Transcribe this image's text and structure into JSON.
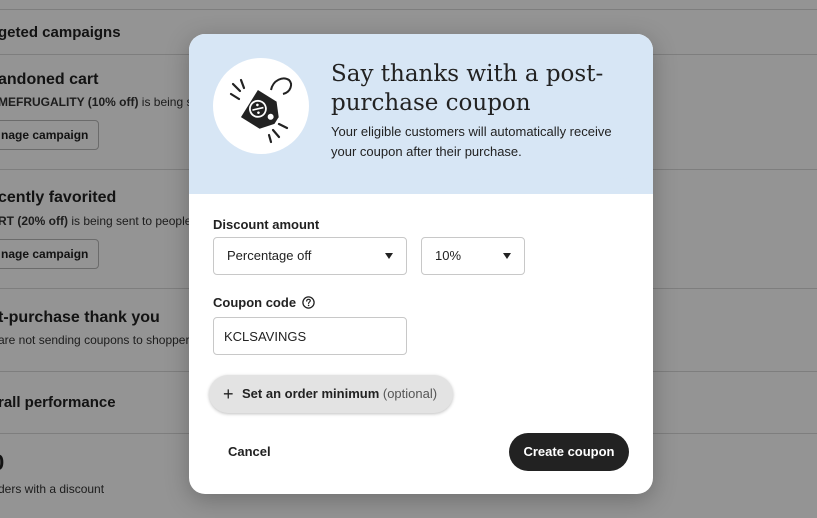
{
  "background": {
    "sections": [
      {
        "title": "geted campaigns"
      },
      {
        "title": "andoned cart",
        "desc_bold": "MEFRUGALITY (10% off)",
        "desc_rest": " is being sent",
        "button": "nage campaign"
      },
      {
        "title": "cently favorited",
        "desc_bold": "RT (20% off)",
        "desc_rest": " is being sent to people",
        "button": "nage campaign"
      },
      {
        "title": "t-purchase thank you",
        "desc_rest": "are not sending coupons to shoppers"
      },
      {
        "title": "rall performance"
      },
      {
        "big_number": "0",
        "desc_rest": "ders with a discount"
      }
    ]
  },
  "modal": {
    "title": "Say thanks with a post-purchase coupon",
    "subtitle": "Your eligible customers will automatically receive your coupon after their purchase.",
    "badge_icon": "coupon-tag-icon",
    "discount_label": "Discount amount",
    "discount_type": {
      "selected": "Percentage off"
    },
    "discount_value": {
      "selected": "10%"
    },
    "coupon_label": "Coupon code",
    "coupon_value": "KCLSAVINGS",
    "order_min": {
      "label": "Set an order minimum",
      "optional": "(optional)"
    },
    "cancel_label": "Cancel",
    "create_label": "Create coupon"
  },
  "colors": {
    "header_bg": "#d7e6f5",
    "primary_button": "#222222",
    "overlay": "rgba(0,0,0,0.42)"
  }
}
